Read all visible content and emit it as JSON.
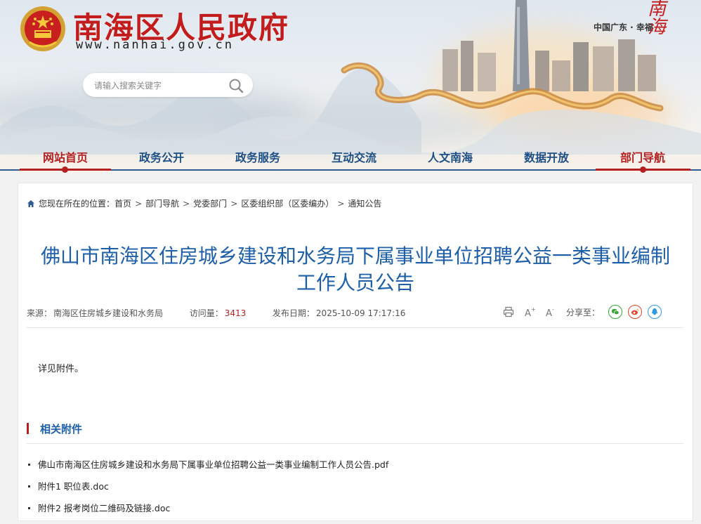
{
  "header": {
    "site_title": "南海区人民政府",
    "site_url": "www.nanhai.gov.cn",
    "slogan": "中国广东 · 幸福",
    "mark": "南海"
  },
  "search": {
    "placeholder": "请输入搜索关键字",
    "icon": "search-icon"
  },
  "nav": {
    "items": [
      {
        "label": "网站首页",
        "active": true
      },
      {
        "label": "政务公开",
        "active": false
      },
      {
        "label": "政务服务",
        "active": false
      },
      {
        "label": "互动交流",
        "active": false
      },
      {
        "label": "人文南海",
        "active": false
      },
      {
        "label": "数据开放",
        "active": false
      },
      {
        "label": "部门导航",
        "active": true
      }
    ]
  },
  "breadcrumb": {
    "prefix": "您现在所在的位置：",
    "items": [
      "首页",
      "部门导航",
      "党委部门",
      "区委组织部（区委编办）",
      "通知公告"
    ],
    "separator": ">"
  },
  "article": {
    "title_line1": "佛山市南海区住房城乡建设和水务局下属事业单位招聘公益一类事业编制",
    "title_line2": "工作人员公告",
    "source_label": "来源：",
    "source": "南海区住房城乡建设和水务局",
    "visits_label": "访问量：",
    "visits": "3413",
    "date_label": "发布日期：",
    "date": "2025-10-09 17:17:16",
    "body": "详见附件。"
  },
  "tools": {
    "print": "print-icon",
    "font_up": "A+",
    "font_down": "A-",
    "share_label": "分享至：",
    "share_targets": [
      "wechat-icon",
      "weibo-icon",
      "qq-icon"
    ]
  },
  "colors": {
    "brand_red": "#c31c1c",
    "brand_blue": "#1d5fa8",
    "wechat": "#3aa33a",
    "weibo": "#e0452b",
    "qq": "#2e9be0"
  },
  "attachments": {
    "heading": "相关附件",
    "items": [
      "佛山市南海区住房城乡建设和水务局下属事业单位招聘公益一类事业编制工作人员公告.pdf",
      "附件1 职位表.doc",
      "附件2 报考岗位二维码及链接.doc"
    ]
  }
}
